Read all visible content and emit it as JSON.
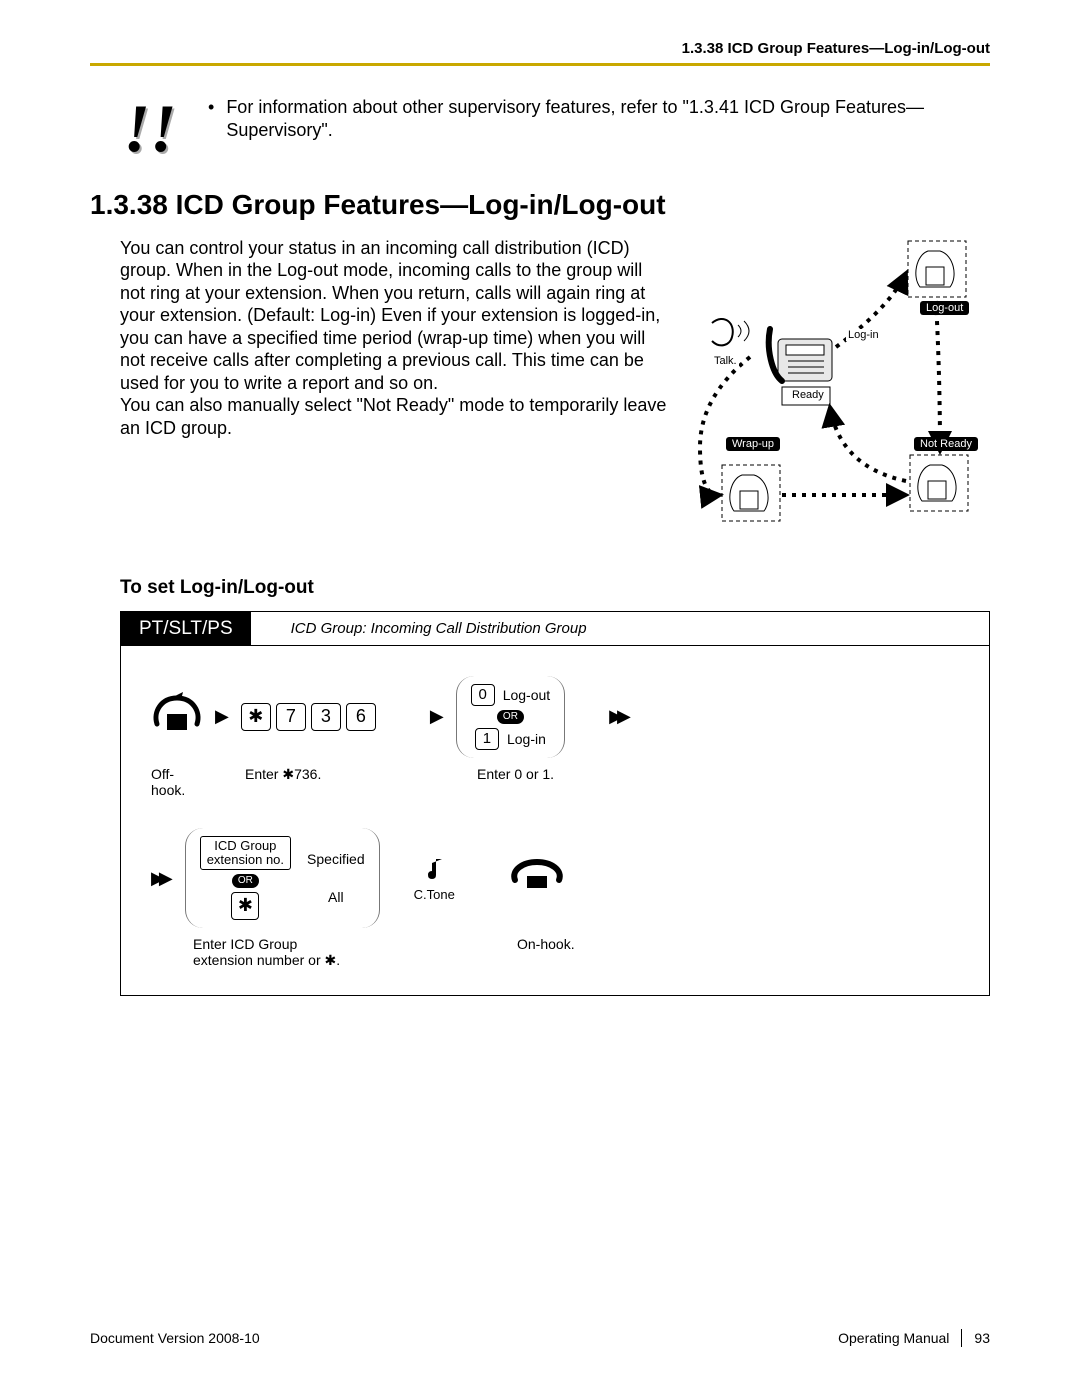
{
  "running_header": "1.3.38 ICD Group Features—Log-in/Log-out",
  "callout": {
    "marker": "!!",
    "bullet": "•",
    "text": "For information about other supervisory features, refer to \"1.3.41  ICD Group Features—Supervisory\"."
  },
  "section_title": "1.3.38  ICD Group Features—Log-in/Log-out",
  "body_paragraph": "You can control your status in an incoming call distribution (ICD) group. When in the Log-out mode, incoming calls to the group will not ring at your extension. When you return, calls will again ring at your extension. (Default: Log-in) Even if your extension is logged-in, you can have a specified time period (wrap-up time) when you will not receive calls after completing a previous call. This time can be used for you to write a report and so on.\nYou can also manually select \"Not Ready\" mode to temporarily leave an ICD group.",
  "diagram": {
    "talk": "Talk.",
    "ready": "Ready",
    "login": "Log-in",
    "logout": "Log-out",
    "wrapup": "Wrap-up",
    "notready": "Not Ready"
  },
  "sub_heading": "To set Log-in/Log-out",
  "proc": {
    "tag": "PT/SLT/PS",
    "note": "ICD Group: Incoming Call Distribution Group",
    "keys": {
      "star": "✱",
      "d7": "7",
      "d3": "3",
      "d6": "6",
      "d0": "0",
      "d1": "1"
    },
    "opts": {
      "logout": "Log-out",
      "or": "OR",
      "login": "Log-in",
      "icd_ext": "ICD Group\nextension no.",
      "specified": "Specified",
      "all": "All",
      "ctone": "C.Tone"
    },
    "captions": {
      "offhook": "Off-hook.",
      "enter736": "Enter ✱736.",
      "enter01": "Enter 0 or 1.",
      "enter_icd": "Enter ICD Group\nextension number or ✱.",
      "onhook": "On-hook."
    }
  },
  "footer": {
    "left": "Document Version  2008-10",
    "manual": "Operating Manual",
    "page": "93"
  }
}
